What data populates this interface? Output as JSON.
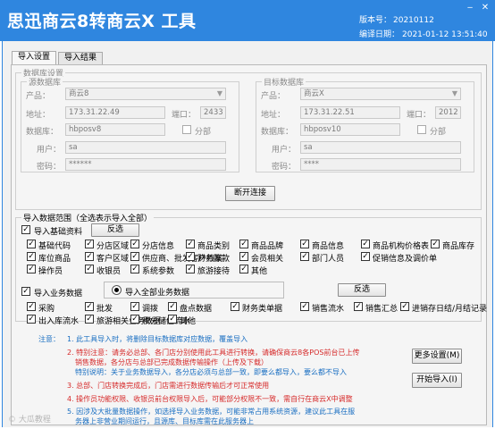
{
  "header": {
    "title": "思迅商云8转商云X 工具",
    "version_label": "版本号：",
    "version_value": "20210112",
    "compile_label": "编译日期：",
    "compile_value": "2021-01-12 13:51:40",
    "bg_color": "#2f86df"
  },
  "tabs": [
    {
      "label": "导入设置",
      "active": true
    },
    {
      "label": "导入结果",
      "active": false
    }
  ],
  "db_settings": {
    "legend": "数据库设置",
    "source": {
      "legend": "源数据库",
      "product_label": "产品：",
      "product_value": "商云8",
      "address_label": "地址：",
      "address_value": "173.31.22.49",
      "port_label": "端口：",
      "port_value": "2433",
      "database_label": "数据库：",
      "database_value": "hbposv8",
      "partition_label": "分部",
      "user_label": "用户：",
      "user_value": "sa",
      "password_label": "密码：",
      "password_value": "******"
    },
    "target": {
      "legend": "目标数据库",
      "product_label": "产品：",
      "product_value": "商云X",
      "address_label": "地址：",
      "address_value": "173.31.22.51",
      "port_label": "端口：",
      "port_value": "2012",
      "database_label": "数据库：",
      "database_value": "hbposv10",
      "partition_label": "分部",
      "user_label": "用户：",
      "user_value": "sa",
      "password_label": "密码：",
      "password_value": "****"
    },
    "disconnect_button": "断开连接"
  },
  "import_scope": {
    "legend": "导入数据范围（全选表示导入全部）",
    "basic": {
      "label": "导入基础资料",
      "invert_button": "反选",
      "items": [
        "基础代码",
        "分店区域",
        "分店信息",
        "商品类别",
        "商品品牌",
        "商品信息",
        "商品机构价格表",
        "商品库存",
        "库位商品",
        "客户区域",
        "供应商、批发客户档案",
        "财务账款",
        "会员相关",
        "部门人员",
        "促销信息及调价单",
        "操作员",
        "收银员",
        "系统参数",
        "旅游接待",
        "其他"
      ]
    },
    "business": {
      "label": "导入业务数据",
      "radio_label": "导入全部业务数据",
      "invert_button": "反选",
      "items": [
        "采购",
        "批发",
        "调拨",
        "盘点数据",
        "财务类单据",
        "销售流水",
        "销售汇总",
        "进销存日结/月结记录",
        "出入库流水",
        "旅游相关业务数据",
        "积分储值流水",
        "其他"
      ]
    }
  },
  "notes": {
    "prefix": "注意：",
    "n1": "1. 此工具导入时，将删除目标数据库对应数据，覆盖导入",
    "n2a": "2. 特别注意：请务必总部、各门店分别使用此工具进行转换，请确保商云8各POS前台已上传",
    "n2b": "销售数据，各分店与总部已完成数据传输操作（上传及下载）",
    "n2c": "特别说明：关于业务数据导入，各分店必须与总部一致，即要么都导入，要么都不导入",
    "n3": "3. 总部、门店转换完成后，门店需进行数据传输后才可正常使用",
    "n4": "4. 操作员功能权限、收银员前台权限导入后，可能部分权限不一致，需自行在商云X中调整",
    "n5a": "5. 因涉及大批量数据操作，如选择导入业务数据，可能非常占用系统资源，建议此工具在服",
    "n5b": "务器上非营业期间运行，且源库、目标库需在此服务器上"
  },
  "actions": {
    "more_settings": "更多设置(M)",
    "start_import": "开始导入(I)"
  },
  "watermark": "© 大瓜教程"
}
